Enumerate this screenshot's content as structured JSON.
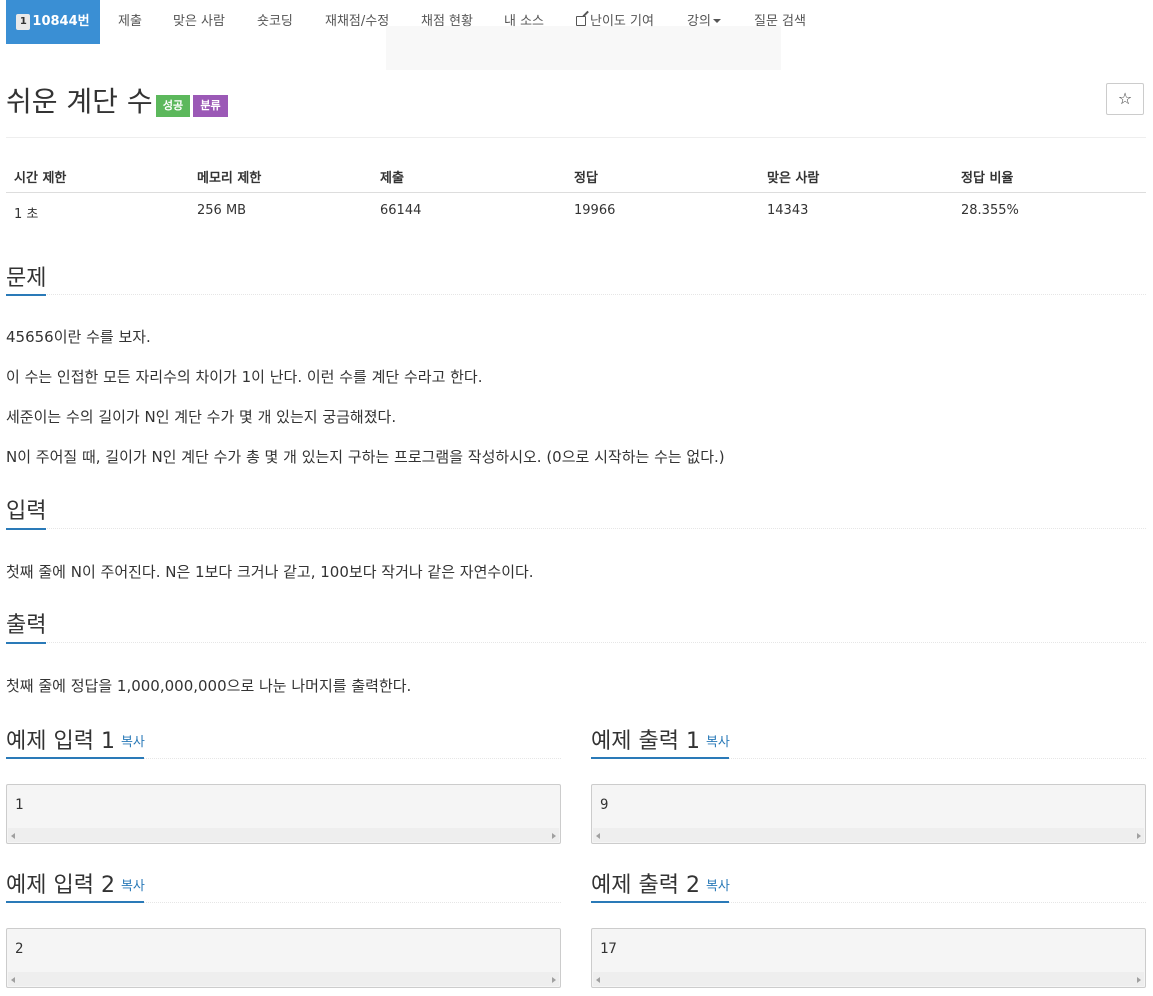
{
  "nav": {
    "problem_number": "10844번",
    "items": [
      "제출",
      "맞은 사람",
      "숏코딩",
      "재채점/수정",
      "채점 현황",
      "내 소스",
      "난이도 기여",
      "강의",
      "질문 검색"
    ]
  },
  "title": "쉬운 계단 수",
  "labels": {
    "success": "성공",
    "category": "분류"
  },
  "star": "☆",
  "info": {
    "headers": [
      "시간 제한",
      "메모리 제한",
      "제출",
      "정답",
      "맞은 사람",
      "정답 비율"
    ],
    "values": [
      "1 초",
      "256 MB",
      "66144",
      "19966",
      "14343",
      "28.355%"
    ]
  },
  "problem": {
    "heading": "문제",
    "paragraphs": [
      "45656이란 수를 보자.",
      "이 수는 인접한 모든 자리수의 차이가 1이 난다. 이런 수를 계단 수라고 한다.",
      "세준이는 수의 길이가 N인 계단 수가 몇 개 있는지 궁금해졌다.",
      "N이 주어질 때, 길이가 N인 계단 수가 총 몇 개 있는지 구하는 프로그램을 작성하시오. (0으로 시작하는 수는 없다.)"
    ]
  },
  "input": {
    "heading": "입력",
    "text": "첫째 줄에 N이 주어진다. N은 1보다 크거나 같고, 100보다 작거나 같은 자연수이다."
  },
  "output": {
    "heading": "출력",
    "text": "첫째 줄에 정답을 1,000,000,000으로 나눈 나머지를 출력한다."
  },
  "samples": {
    "copy": "복사",
    "input1": {
      "title": "예제 입력 1",
      "value": "1"
    },
    "output1": {
      "title": "예제 출력 1",
      "value": "9"
    },
    "input2": {
      "title": "예제 입력 2",
      "value": "2"
    },
    "output2": {
      "title": "예제 출력 2",
      "value": "17"
    }
  },
  "colors": {
    "accent": "#3a8fd4",
    "success": "#5cb85c",
    "category": "#9b59b6",
    "link": "#2a7ab8"
  }
}
